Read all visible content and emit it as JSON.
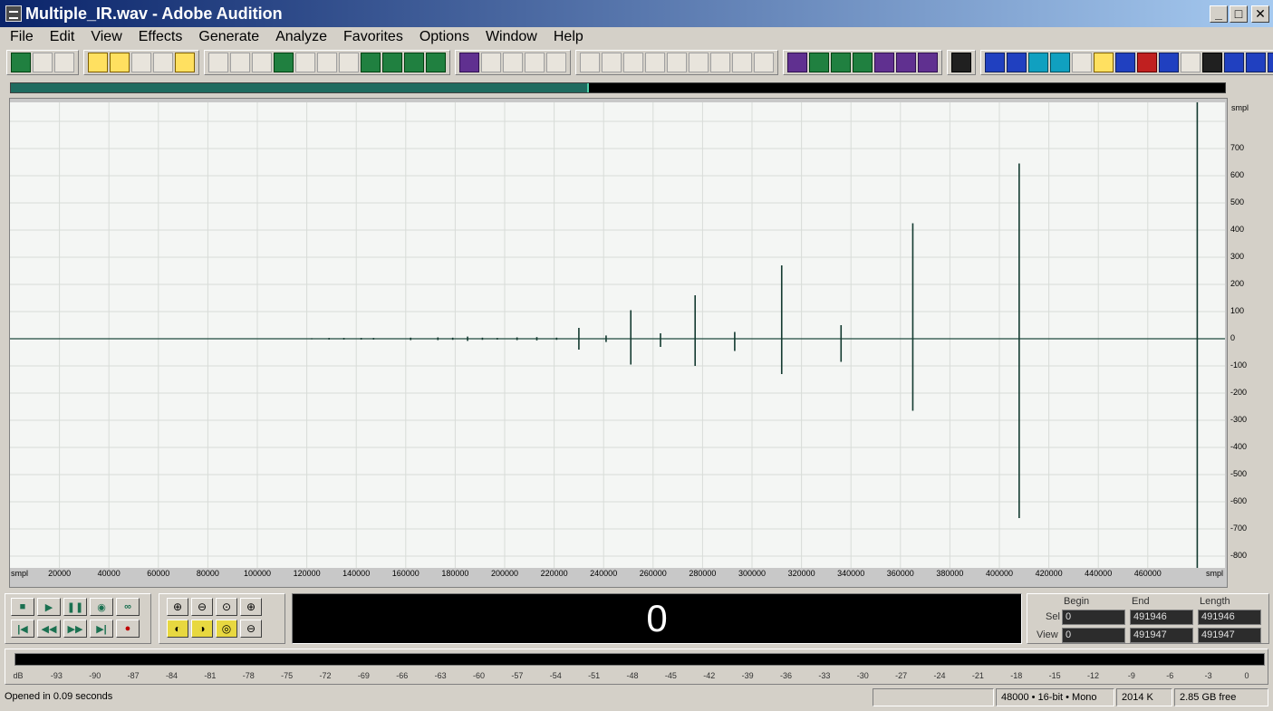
{
  "window": {
    "title": "Multiple_IR.wav - Adobe Audition",
    "minimize": "_",
    "maximize": "□",
    "close": "✕"
  },
  "menu": [
    "File",
    "Edit",
    "View",
    "Effects",
    "Generate",
    "Analyze",
    "Favorites",
    "Options",
    "Window",
    "Help"
  ],
  "toolbar": {
    "groups": [
      [
        {
          "icon": "multitrack-view-icon",
          "style": "green"
        },
        {
          "icon": "edit-view-icon",
          "style": "plain"
        },
        {
          "icon": "cd-view-icon",
          "style": "plain"
        }
      ],
      [
        {
          "icon": "new-file-icon",
          "style": "yellow"
        },
        {
          "icon": "open-file-icon",
          "style": "yellow"
        },
        {
          "icon": "save-icon",
          "style": "plain"
        },
        {
          "icon": "save-as-icon",
          "style": "plain"
        },
        {
          "icon": "save-all-icon",
          "style": "yellow"
        }
      ],
      [
        {
          "icon": "undo-icon",
          "style": "plain"
        },
        {
          "icon": "redo-icon",
          "style": "plain"
        },
        {
          "icon": "repeat-icon",
          "style": "plain"
        },
        {
          "icon": "copy-new-icon",
          "style": "green"
        },
        {
          "icon": "copy-icon",
          "style": "plain"
        },
        {
          "icon": "cut-icon",
          "style": "plain"
        },
        {
          "icon": "paste-icon",
          "style": "plain"
        },
        {
          "icon": "paste-new-icon",
          "style": "green"
        },
        {
          "icon": "mix-paste-icon",
          "style": "green"
        },
        {
          "icon": "trim-icon",
          "style": "green"
        },
        {
          "icon": "loop-icon",
          "style": "green"
        }
      ],
      [
        {
          "icon": "envelope-icon",
          "style": "purple"
        },
        {
          "icon": "fade-icon",
          "style": "plain"
        },
        {
          "icon": "tool-1-icon",
          "style": "plain"
        },
        {
          "icon": "tool-2-icon",
          "style": "plain"
        },
        {
          "icon": "tool-3-icon",
          "style": "plain"
        }
      ],
      [
        {
          "icon": "window-1-icon",
          "style": "plain"
        },
        {
          "icon": "window-2-icon",
          "style": "plain"
        },
        {
          "icon": "window-3-icon",
          "style": "plain"
        },
        {
          "icon": "play-window-icon",
          "style": "plain"
        },
        {
          "icon": "zoom-window-icon",
          "style": "plain"
        },
        {
          "icon": "time-window-icon",
          "style": "plain"
        },
        {
          "icon": "grid-window-icon",
          "style": "plain"
        },
        {
          "icon": "color-window-icon",
          "style": "plain"
        },
        {
          "icon": "blank-window-icon",
          "style": "plain"
        }
      ],
      [
        {
          "icon": "plugin-1-icon",
          "style": "purple"
        },
        {
          "icon": "irs-plugin-icon",
          "style": "green"
        },
        {
          "icon": "mls-plugin-icon",
          "style": "green"
        },
        {
          "icon": "wave-plugin-icon",
          "style": "green"
        },
        {
          "icon": "plugin-5-icon",
          "style": "purple"
        },
        {
          "icon": "plugin-6-icon",
          "style": "purple"
        },
        {
          "icon": "plugin-7-icon",
          "style": "purple"
        }
      ],
      [
        {
          "icon": "acoustics-icon",
          "style": "dark"
        }
      ],
      [
        {
          "icon": "ap-icon",
          "style": "blue"
        },
        {
          "icon": "ap42-icon",
          "style": "blue"
        },
        {
          "icon": "mq-icon",
          "style": "cyan"
        },
        {
          "icon": "varp-icon",
          "style": "cyan"
        },
        {
          "icon": "pattern-icon",
          "style": "plain"
        },
        {
          "icon": "chart-icon",
          "style": "yellow"
        },
        {
          "icon": "filter-icon",
          "style": "blue"
        },
        {
          "icon": "spectrum-icon",
          "style": "red"
        },
        {
          "icon": "bars-icon",
          "style": "blue"
        },
        {
          "icon": "brackets-icon",
          "style": "plain"
        },
        {
          "icon": "color-bars-icon",
          "style": "dark"
        },
        {
          "icon": "itu-p56-icon",
          "style": "blue"
        },
        {
          "icon": "sti-icon",
          "style": "blue"
        },
        {
          "icon": "ff-icon",
          "style": "blue"
        }
      ]
    ]
  },
  "waveform": {
    "unit": "smpl",
    "y_ticks": [
      "700",
      "600",
      "500",
      "400",
      "300",
      "200",
      "100",
      "0",
      "-100",
      "-200",
      "-300",
      "-400",
      "-500",
      "-600",
      "-700",
      "-800"
    ],
    "x_ticks": [
      "20000",
      "40000",
      "60000",
      "80000",
      "100000",
      "120000",
      "140000",
      "160000",
      "180000",
      "200000",
      "220000",
      "240000",
      "260000",
      "280000",
      "300000",
      "320000",
      "340000",
      "360000",
      "380000",
      "400000",
      "420000",
      "440000",
      "460000"
    ],
    "overview_fraction": 0.476,
    "spikes": [
      {
        "x": 122000,
        "top": 2,
        "bot": -2
      },
      {
        "x": 129000,
        "top": 3,
        "bot": -3
      },
      {
        "x": 135000,
        "top": 3,
        "bot": -3
      },
      {
        "x": 142000,
        "top": 3,
        "bot": -3
      },
      {
        "x": 147000,
        "top": 3,
        "bot": -3
      },
      {
        "x": 162000,
        "top": 4,
        "bot": -5
      },
      {
        "x": 173000,
        "top": 5,
        "bot": -5
      },
      {
        "x": 179000,
        "top": 4,
        "bot": -4
      },
      {
        "x": 185000,
        "top": 8,
        "bot": -8
      },
      {
        "x": 191000,
        "top": 4,
        "bot": -4
      },
      {
        "x": 197000,
        "top": 3,
        "bot": -3
      },
      {
        "x": 205000,
        "top": 5,
        "bot": -5
      },
      {
        "x": 213000,
        "top": 6,
        "bot": -6
      },
      {
        "x": 221000,
        "top": 4,
        "bot": -4
      },
      {
        "x": 230000,
        "top": 40,
        "bot": -40
      },
      {
        "x": 241000,
        "top": 12,
        "bot": -12
      },
      {
        "x": 251000,
        "top": 105,
        "bot": -95
      },
      {
        "x": 263000,
        "top": 20,
        "bot": -30
      },
      {
        "x": 277000,
        "top": 160,
        "bot": -100
      },
      {
        "x": 293000,
        "top": 25,
        "bot": -45
      },
      {
        "x": 312000,
        "top": 270,
        "bot": -130
      },
      {
        "x": 336000,
        "top": 50,
        "bot": -85
      },
      {
        "x": 365000,
        "top": 425,
        "bot": -265
      },
      {
        "x": 408000,
        "top": 645,
        "bot": -660
      },
      {
        "x": 480000,
        "top": 870,
        "bot": -860
      }
    ],
    "max_x": 491947
  },
  "transport": {
    "row1": [
      {
        "icon": "stop-icon",
        "glyph": "■"
      },
      {
        "icon": "play-icon",
        "glyph": "▶"
      },
      {
        "icon": "pause-icon",
        "glyph": "❚❚"
      },
      {
        "icon": "play-to-end-icon",
        "glyph": "◉"
      },
      {
        "icon": "loop-play-icon",
        "glyph": "∞"
      }
    ],
    "row2": [
      {
        "icon": "go-to-start-icon",
        "glyph": "|◀"
      },
      {
        "icon": "rewind-icon",
        "glyph": "◀◀"
      },
      {
        "icon": "fast-forward-icon",
        "glyph": "▶▶"
      },
      {
        "icon": "go-to-end-icon",
        "glyph": "▶|"
      },
      {
        "icon": "record-icon",
        "glyph": "●"
      }
    ]
  },
  "zoom": {
    "row1": [
      {
        "icon": "zoom-in-h-icon",
        "glyph": "⊕"
      },
      {
        "icon": "zoom-out-h-icon",
        "glyph": "⊖"
      },
      {
        "icon": "zoom-full-icon",
        "glyph": "⊙"
      },
      {
        "icon": "zoom-in-v-icon",
        "glyph": "⊕"
      }
    ],
    "row2": [
      {
        "icon": "zoom-left-icon",
        "glyph": "◐"
      },
      {
        "icon": "zoom-right-icon",
        "glyph": "◑"
      },
      {
        "icon": "zoom-selection-icon",
        "glyph": "◎"
      },
      {
        "icon": "zoom-out-v-icon",
        "glyph": "⊖"
      }
    ]
  },
  "time_display": "0",
  "selection": {
    "headers": {
      "begin": "Begin",
      "end": "End",
      "length": "Length"
    },
    "sel_label": "Sel",
    "view_label": "View",
    "sel": {
      "begin": "0",
      "end": "491946",
      "length": "491946"
    },
    "view": {
      "begin": "0",
      "end": "491947",
      "length": "491947"
    }
  },
  "meter": {
    "ticks": [
      "dB",
      "-93",
      "-90",
      "-87",
      "-84",
      "-81",
      "-78",
      "-75",
      "-72",
      "-69",
      "-66",
      "-63",
      "-60",
      "-57",
      "-54",
      "-51",
      "-48",
      "-45",
      "-42",
      "-39",
      "-36",
      "-33",
      "-30",
      "-27",
      "-24",
      "-21",
      "-18",
      "-15",
      "-12",
      "-9",
      "-6",
      "-3",
      "0"
    ]
  },
  "status": {
    "message": "Opened in 0.09 seconds",
    "format": "48000 • 16-bit • Mono",
    "size": "2014 K",
    "free": "2.85 GB free"
  }
}
